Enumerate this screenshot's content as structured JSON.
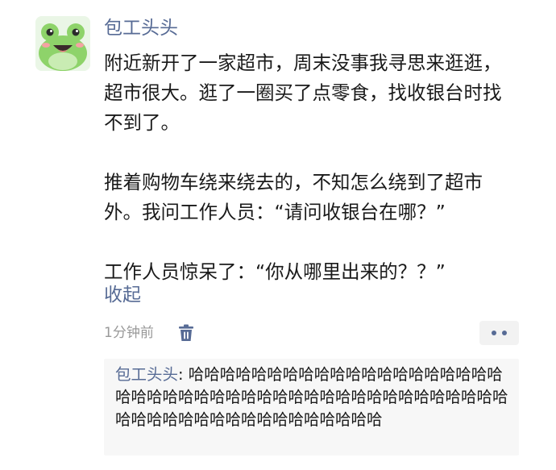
{
  "post": {
    "username": "包工头头",
    "paragraphs": [
      "附近新开了一家超市，周末没事我寻思来逛逛，超市很大。逛了一圈买了点零食，找收银台时找不到了。",
      "推着购物车绕来绕去的，不知怎么绕到了超市外。我问工作人员：“请问收银台在哪？”",
      "工作人员惊呆了：“你从哪里出来的？？”"
    ],
    "collapse_label": "收起",
    "timestamp": "1分钟前"
  },
  "icons": {
    "avatar": "frog-avatar",
    "delete": "trash-icon",
    "more": "more-dots-icon"
  },
  "comment": {
    "author": "包工头头",
    "separator": ": ",
    "text": "哈哈哈哈哈哈哈哈哈哈哈哈哈哈哈哈哈哈哈哈哈哈哈哈哈哈哈哈哈哈哈哈哈哈哈哈哈哈哈哈哈哈哈哈哈哈哈哈哈哈哈哈哈哈哈哈哈哈哈哈哈哈"
  },
  "colors": {
    "link": "#576b95",
    "text": "#1a1a1a",
    "muted": "#999999",
    "comment_bg": "#f7f7f7",
    "avatar_green": "#8ed36a"
  }
}
